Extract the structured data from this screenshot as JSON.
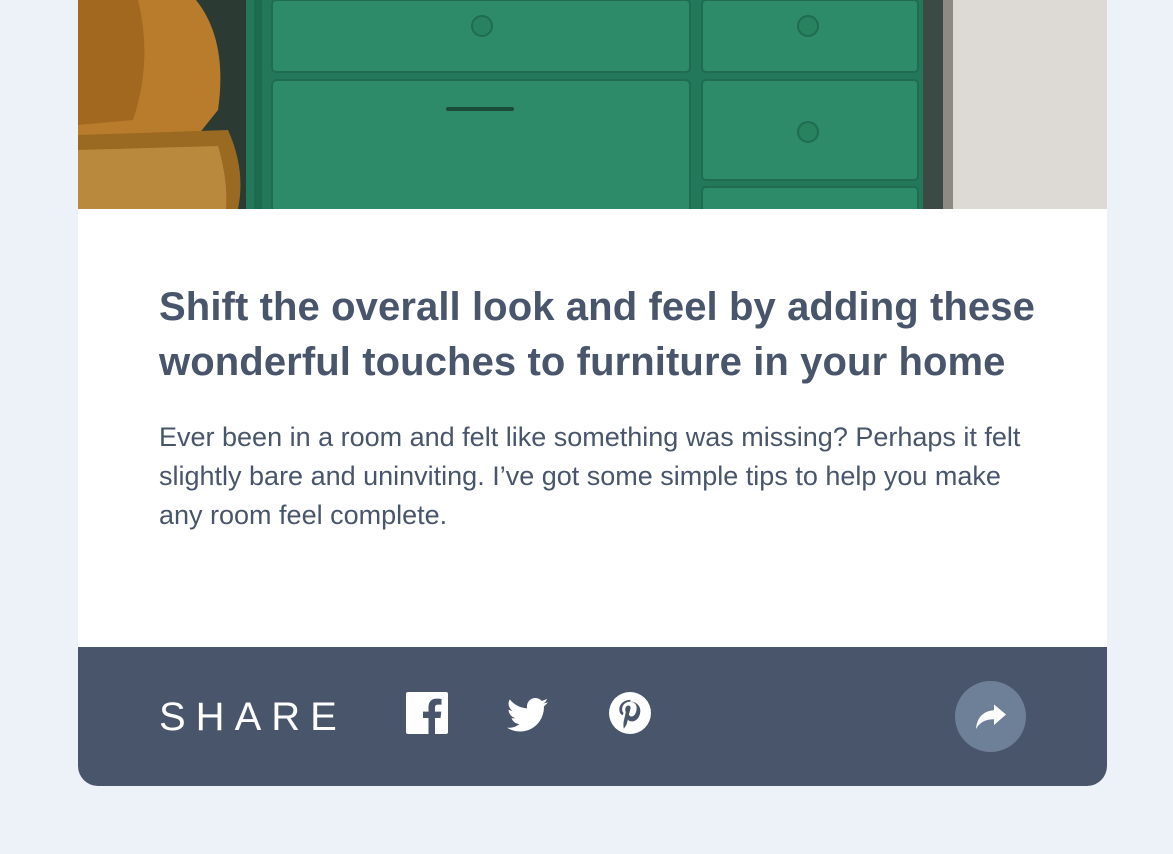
{
  "article": {
    "title": "Shift the overall look and feel by adding these wonderful touches to furniture in your home",
    "description": "Ever been in a room and felt like something was missing? Perhaps it felt slightly bare and uninviting. I’ve got some simple tips to help you make any room feel complete."
  },
  "share": {
    "label": "SHARE",
    "icons": [
      "facebook-icon",
      "twitter-icon",
      "pinterest-icon",
      "share-arrow-icon"
    ]
  },
  "colors": {
    "page_background": "#ECF2F8",
    "card_background": "#FFFFFF",
    "text": "#48556A",
    "share_bar": "#48556A",
    "share_button": "#6E8098",
    "drawer_green": "#2E8B6A",
    "chair_ochre": "#B07A2E"
  }
}
